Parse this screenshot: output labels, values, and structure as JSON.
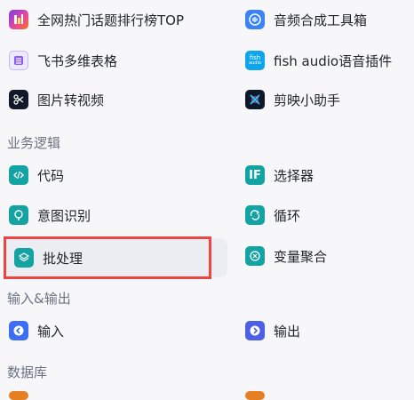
{
  "tools": {
    "items": [
      {
        "label": "全网热门话题排行榜TOP"
      },
      {
        "label": "音频合成工具箱"
      },
      {
        "label": "飞书多维表格"
      },
      {
        "label": "fish audio语音插件",
        "icon_text_top": "fish",
        "icon_text_bottom": "audio"
      },
      {
        "label": "图片转视频"
      },
      {
        "label": "剪映小助手"
      }
    ]
  },
  "logic": {
    "title": "业务逻辑",
    "items": [
      {
        "label": "代码"
      },
      {
        "label": "选择器",
        "icon_text": "IF"
      },
      {
        "label": "意图识别"
      },
      {
        "label": "循环"
      },
      {
        "label": "批处理"
      },
      {
        "label": "变量聚合"
      }
    ]
  },
  "io": {
    "title": "输入&输出",
    "items": [
      {
        "label": "输入"
      },
      {
        "label": "输出"
      }
    ]
  },
  "database": {
    "title": "数据库"
  },
  "colors": {
    "teal": "#14a3a3",
    "blue_in": "#3b6ef5",
    "blue_out": "#4c5fe6",
    "highlight": "#ef4444",
    "orange": "#e67e22"
  }
}
